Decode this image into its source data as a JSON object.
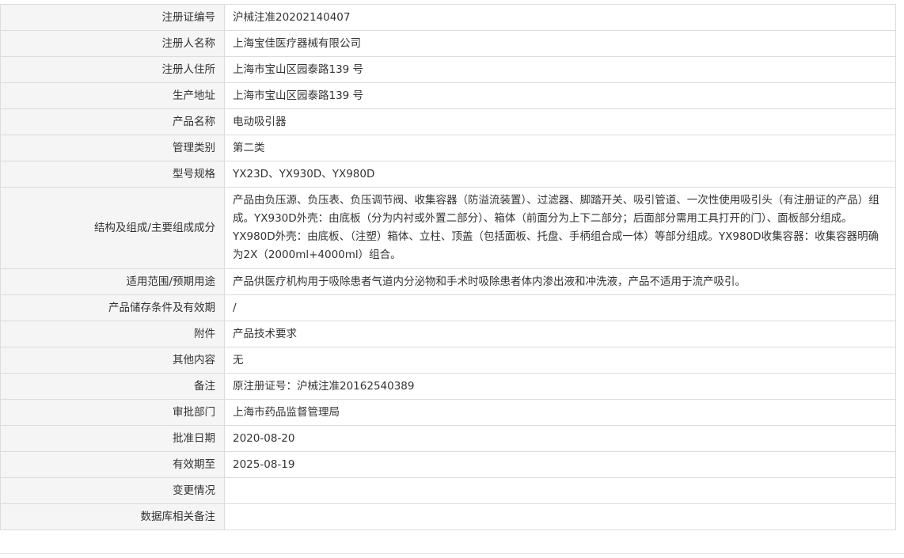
{
  "rows": [
    {
      "label": "注册证编号",
      "value": "沪械注准20202140407"
    },
    {
      "label": "注册人名称",
      "value": "上海宝佳医疗器械有限公司"
    },
    {
      "label": "注册人住所",
      "value": "上海市宝山区园泰路139 号"
    },
    {
      "label": "生产地址",
      "value": "上海市宝山区园泰路139 号"
    },
    {
      "label": "产品名称",
      "value": "电动吸引器"
    },
    {
      "label": "管理类别",
      "value": "第二类"
    },
    {
      "label": "型号规格",
      "value": "YX23D、YX930D、YX980D"
    },
    {
      "label": "结构及组成/主要组成成分",
      "value": "产品由负压源、负压表、负压调节阀、收集容器（防溢流装置）、过滤器、脚踏开关、吸引管道、一次性使用吸引头（有注册证的产品）组成。YX930D外壳：由底板（分为内衬或外置二部分）、箱体（前面分为上下二部分；后面部分需用工具打开的门）、面板部分组成。YX980D外壳：由底板、（注塑）箱体、立柱、顶盖（包括面板、托盘、手柄组合成一体）等部分组成。YX980D收集容器：收集容器明确为2X（2000ml+4000ml）组合。"
    },
    {
      "label": "适用范围/预期用途",
      "value": "产品供医疗机构用于吸除患者气道内分泌物和手术时吸除患者体内渗出液和冲洗液，产品不适用于流产吸引。"
    },
    {
      "label": "产品储存条件及有效期",
      "value": "/"
    },
    {
      "label": "附件",
      "value": "产品技术要求"
    },
    {
      "label": "其他内容",
      "value": "无"
    },
    {
      "label": "备注",
      "value": "原注册证号：沪械注准20162540389"
    },
    {
      "label": "审批部门",
      "value": "上海市药品监督管理局"
    },
    {
      "label": "批准日期",
      "value": "2020-08-20"
    },
    {
      "label": "有效期至",
      "value": "2025-08-19"
    },
    {
      "label": "变更情况",
      "value": ""
    },
    {
      "label": "数据库相关备注",
      "value": ""
    }
  ]
}
